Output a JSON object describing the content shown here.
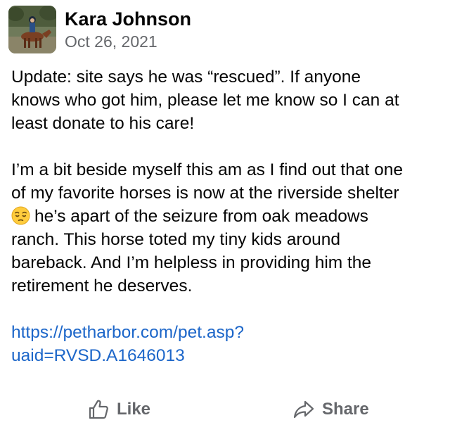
{
  "post": {
    "author": "Kara Johnson",
    "date": "Oct 26, 2021",
    "avatar_icon": "profile-photo-horse-rider",
    "paragraph1": {
      "line1": "Update: site says he was “rescued”. If anyone",
      "line2": "knows who got him, please let me know so I can at",
      "line3": "least donate to his care!"
    },
    "paragraph2": {
      "line1": "I’m a bit beside myself this am as I find out that one",
      "line2": "of my favorite horses is now at the riverside shelter",
      "emoji": "pensive-face-emoji",
      "line3": "he’s apart of the seizure from oak meadows",
      "line4": "ranch. This horse toted my tiny kids around",
      "line5": "bareback. And I’m helpless in providing him the",
      "line6": "retirement he deserves."
    },
    "link": {
      "line1": "https://petharbor.com/pet.asp?",
      "line2": "uaid=RVSD.A1646013",
      "color": "#1c66c9"
    }
  },
  "actions": {
    "like_label": "Like",
    "share_label": "Share",
    "color": "#65676b"
  }
}
